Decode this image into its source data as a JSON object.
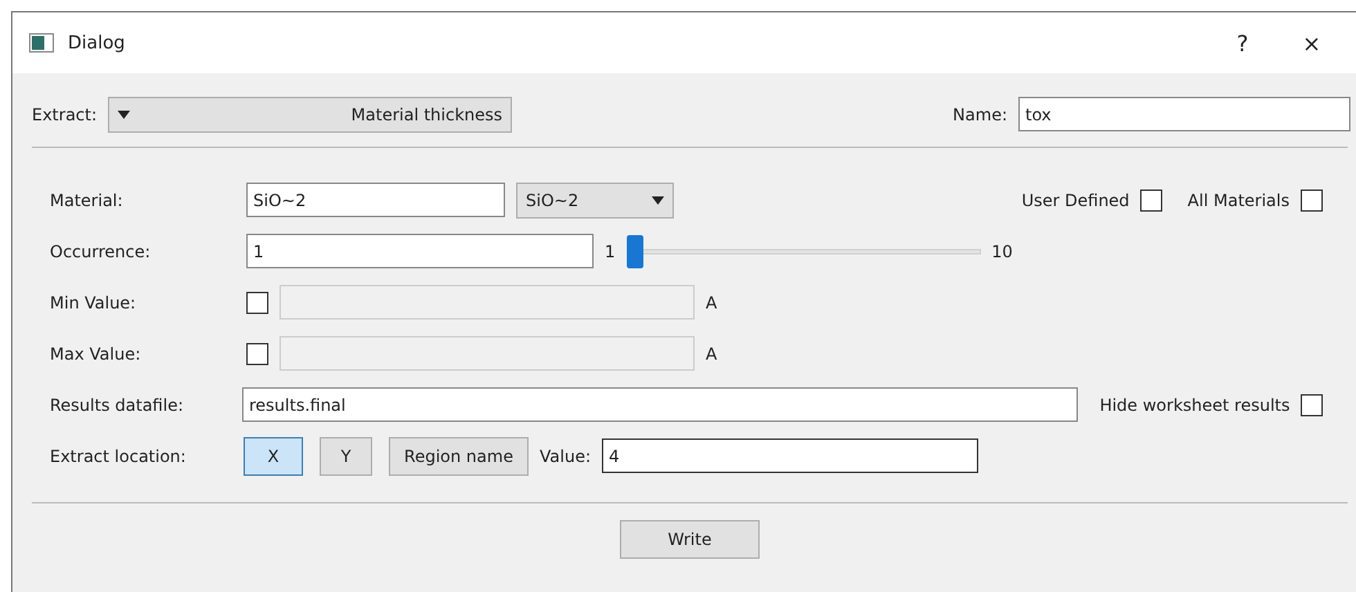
{
  "window": {
    "title": "Dialog",
    "help": "?",
    "close": "×"
  },
  "extract": {
    "label": "Extract:",
    "value": "Material thickness"
  },
  "name": {
    "label": "Name:",
    "value": "tox"
  },
  "material": {
    "label": "Material:",
    "value": "SiO~2",
    "combo": "SiO~2"
  },
  "options": [
    {
      "label": "User Defined",
      "checked": false
    },
    {
      "label": "All Materials",
      "checked": false
    }
  ],
  "occurrence": {
    "label": "Occurrence:",
    "value": "1",
    "min_label": "1",
    "max_label": "10",
    "level": 0
  },
  "limits": [
    {
      "label": "Min Value:",
      "checked": false,
      "unit": "A",
      "disabled": true
    },
    {
      "label": "Max Value:",
      "checked": false,
      "unit": "A",
      "disabled": true
    }
  ],
  "results": {
    "label": "Results datafile:",
    "value": "results.final",
    "hide_label": "Hide worksheet results",
    "hide_checked": false
  },
  "location": {
    "label": "Extract location:",
    "buttons": [
      {
        "label": "X",
        "selected": true
      },
      {
        "label": "Y",
        "selected": false
      },
      {
        "label": "Region name",
        "selected": false
      }
    ],
    "value_label": "Value:",
    "value": "4"
  },
  "buttons": [
    "Write"
  ]
}
